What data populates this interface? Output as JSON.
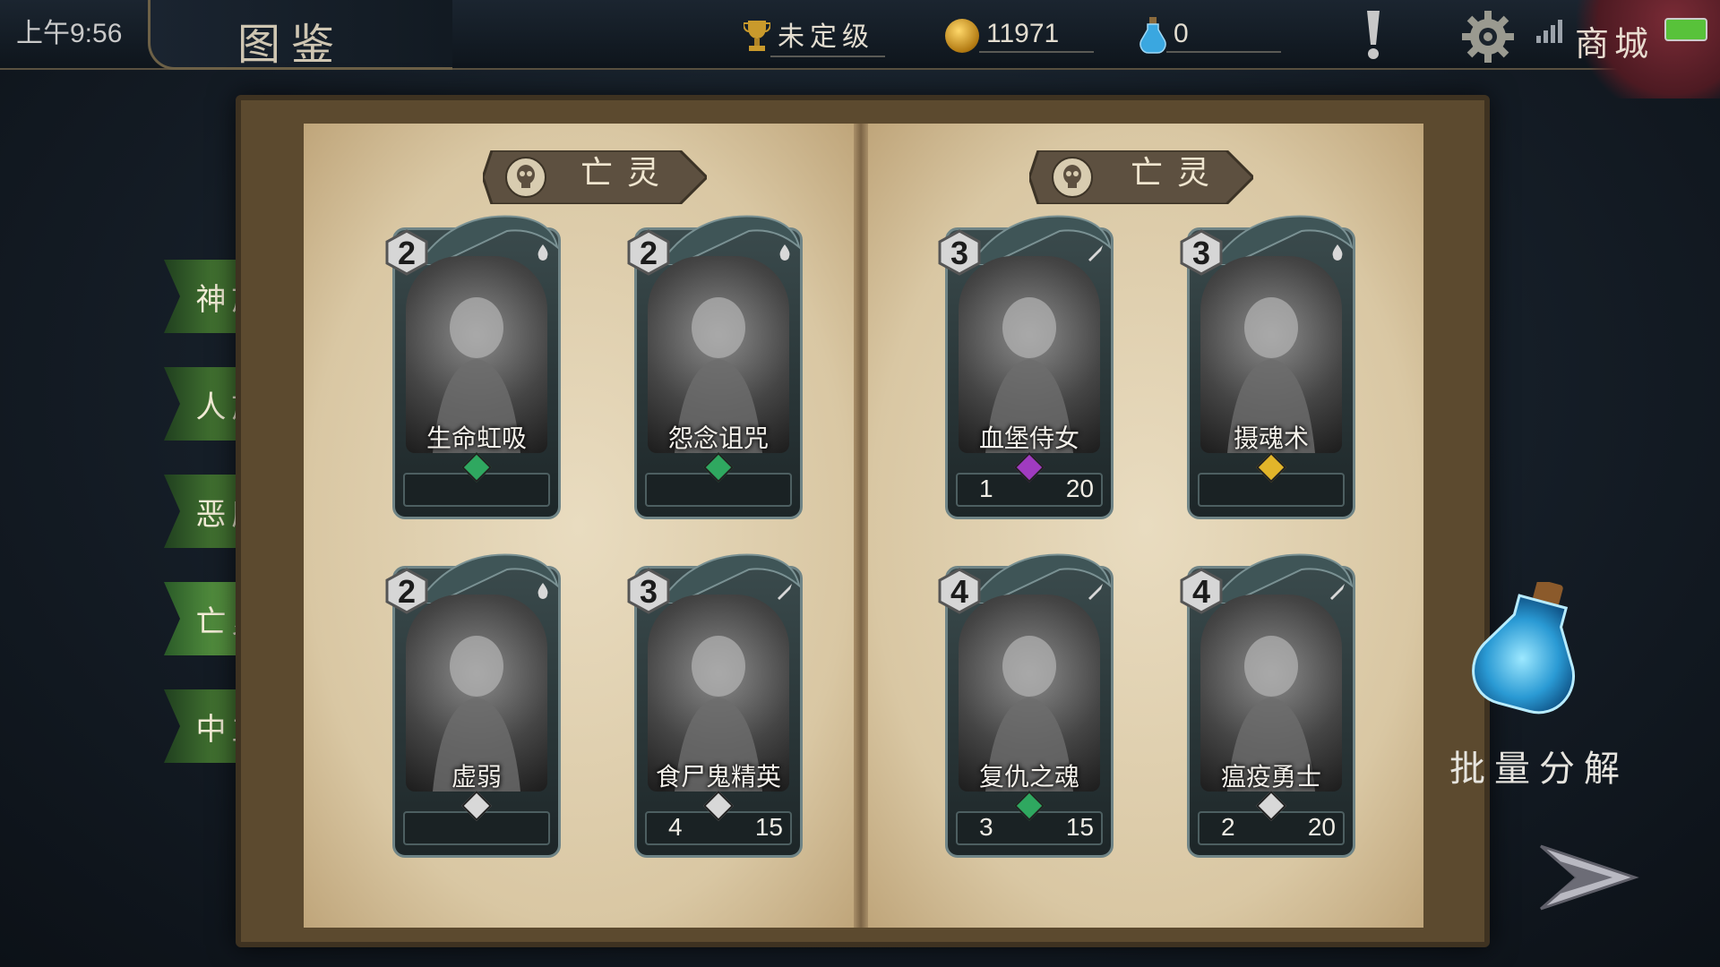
{
  "status": {
    "time": "上午9:56"
  },
  "header": {
    "title": "图鉴",
    "rank": "未定级",
    "coins": "11971",
    "potions": "0",
    "shop_label": "商城"
  },
  "book": {
    "left_title": "亡灵",
    "right_title": "亡灵"
  },
  "categories": [
    {
      "label": "神族",
      "active": false
    },
    {
      "label": "人族",
      "active": false
    },
    {
      "label": "恶魔",
      "active": false
    },
    {
      "label": "亡灵",
      "active": true
    },
    {
      "label": "中立",
      "active": false
    }
  ],
  "cards": [
    {
      "name": "生命虹吸",
      "cost": "2",
      "count": "",
      "max": "",
      "gem": "#2fa860",
      "icon": "drop-icon"
    },
    {
      "name": "怨念诅咒",
      "cost": "2",
      "count": "",
      "max": "",
      "gem": "#2fa860",
      "icon": "drop-icon"
    },
    {
      "name": "血堡侍女",
      "cost": "3",
      "count": "1",
      "max": "20",
      "gem": "#a03bc0",
      "icon": "sword-icon"
    },
    {
      "name": "摄魂术",
      "cost": "3",
      "count": "",
      "max": "",
      "gem": "#e2b52a",
      "icon": "drop-icon"
    },
    {
      "name": "虚弱",
      "cost": "2",
      "count": "",
      "max": "",
      "gem": "#d8d8d8",
      "icon": "drop-icon"
    },
    {
      "name": "食尸鬼精英",
      "cost": "3",
      "count": "4",
      "max": "15",
      "gem": "#d8d8d8",
      "icon": "sword-icon"
    },
    {
      "name": "复仇之魂",
      "cost": "4",
      "count": "3",
      "max": "15",
      "gem": "#2fa860",
      "icon": "sword-icon"
    },
    {
      "name": "瘟疫勇士",
      "cost": "4",
      "count": "2",
      "max": "20",
      "gem": "#d8d8d8",
      "icon": "sword-icon"
    }
  ],
  "decompose": {
    "label": "批量分解"
  }
}
